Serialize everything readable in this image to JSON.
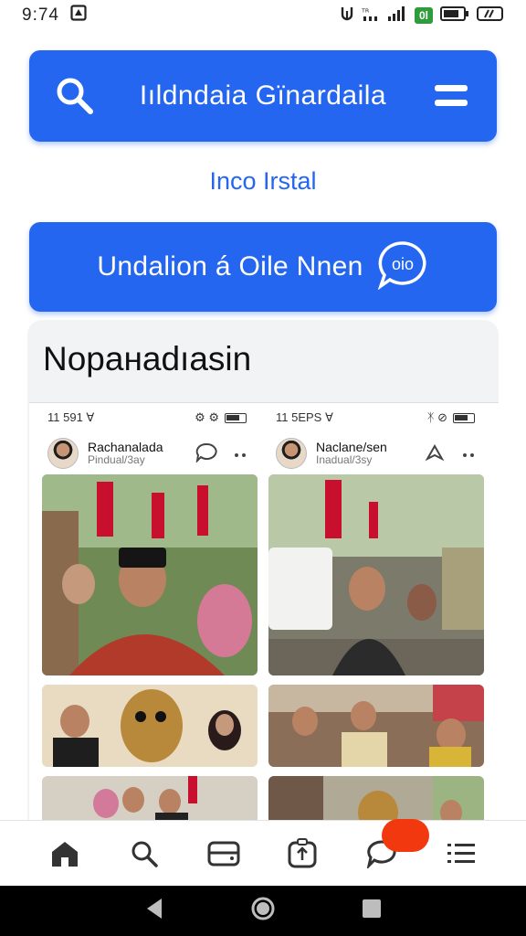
{
  "status_bar": {
    "time": "9:74",
    "icons": [
      "notification-icon",
      "vibrate-icon",
      "data-icon",
      "signal-icon",
      "network-badge-icon",
      "battery-icon",
      "wifi-icon"
    ]
  },
  "search_bar": {
    "title": "Iıldndaia Gïnardaila",
    "left_icon": "search-icon",
    "right_icon": "hamburger-menu-icon"
  },
  "link_text": "Inco Irstal",
  "cta_button": {
    "label": "Undalion á Oile Nnen",
    "icon": "chat-bubble-icon",
    "icon_text": "oio"
  },
  "card": {
    "title": "Nopaнadıasin",
    "columns": [
      {
        "status_time": "11 591 ∀",
        "status_icons": "⚙ ⚙",
        "profile_name": "Rachanalada",
        "profile_sub": "Pindual/3ay"
      },
      {
        "status_time": "11 5EPS ∀",
        "status_icons": "ᛡ ⊘",
        "profile_name": "Naclane/sen",
        "profile_sub": "Inadual/3sy"
      }
    ]
  },
  "bottom_nav": {
    "items": [
      "home-icon",
      "search-icon",
      "wallet-icon",
      "upload-icon",
      "chat-icon",
      "menu-list-icon"
    ]
  },
  "colors": {
    "primary": "#2466ef",
    "notification": "#f2380f"
  }
}
